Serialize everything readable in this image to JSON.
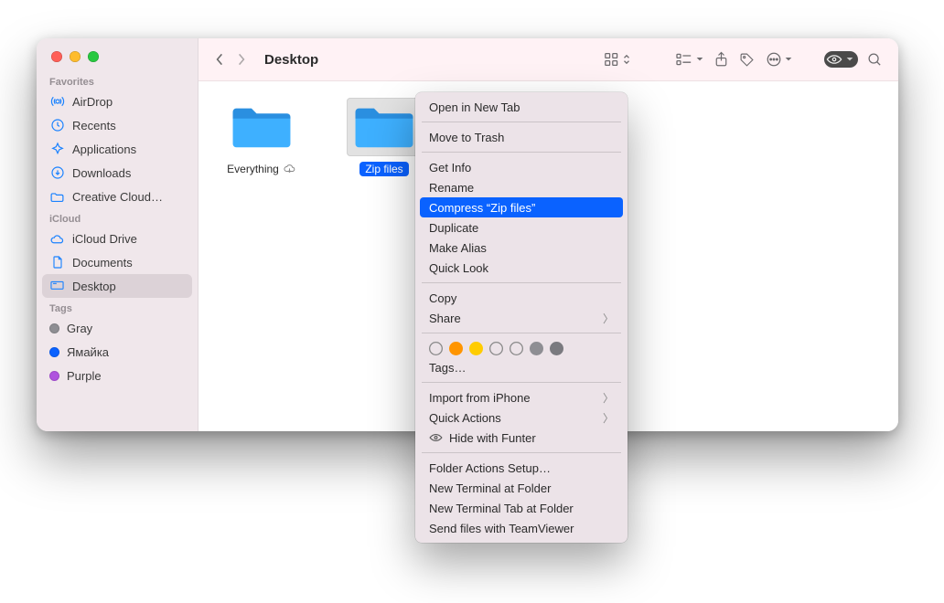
{
  "sidebar": {
    "sections": {
      "favorites": {
        "header": "Favorites",
        "items": [
          "AirDrop",
          "Recents",
          "Applications",
          "Downloads",
          "Creative Cloud…"
        ]
      },
      "icloud": {
        "header": "iCloud",
        "items": [
          "iCloud Drive",
          "Documents",
          "Desktop"
        ]
      },
      "tags": {
        "header": "Tags",
        "items": [
          {
            "label": "Gray",
            "color": "#8e8e93"
          },
          {
            "label": "Ямайка",
            "color": "#0a62ff"
          },
          {
            "label": "Purple",
            "color": "#af52de"
          }
        ]
      }
    }
  },
  "toolbar": {
    "title": "Desktop"
  },
  "files": [
    {
      "name": "Everything",
      "selected": false,
      "cloud": true
    },
    {
      "name": "Zip files",
      "selected": true,
      "cloud": false
    }
  ],
  "context_menu": {
    "open_new_tab": "Open in New Tab",
    "move_to_trash": "Move to Trash",
    "get_info": "Get Info",
    "rename": "Rename",
    "compress": "Compress “Zip files”",
    "duplicate": "Duplicate",
    "make_alias": "Make Alias",
    "quick_look": "Quick Look",
    "copy": "Copy",
    "share": "Share",
    "tags_label": "Tags…",
    "import_iphone": "Import from iPhone",
    "quick_actions": "Quick Actions",
    "hide_funter": "Hide with Funter",
    "folder_actions": "Folder Actions Setup…",
    "new_terminal": "New Terminal at Folder",
    "new_terminal_tab": "New Terminal Tab at Folder",
    "send_teamviewer": "Send files with TeamViewer",
    "tag_colors": [
      "",
      "#ff9500",
      "#ffcc00",
      "",
      "",
      "#8e8e93",
      "#7a7a7f"
    ]
  }
}
